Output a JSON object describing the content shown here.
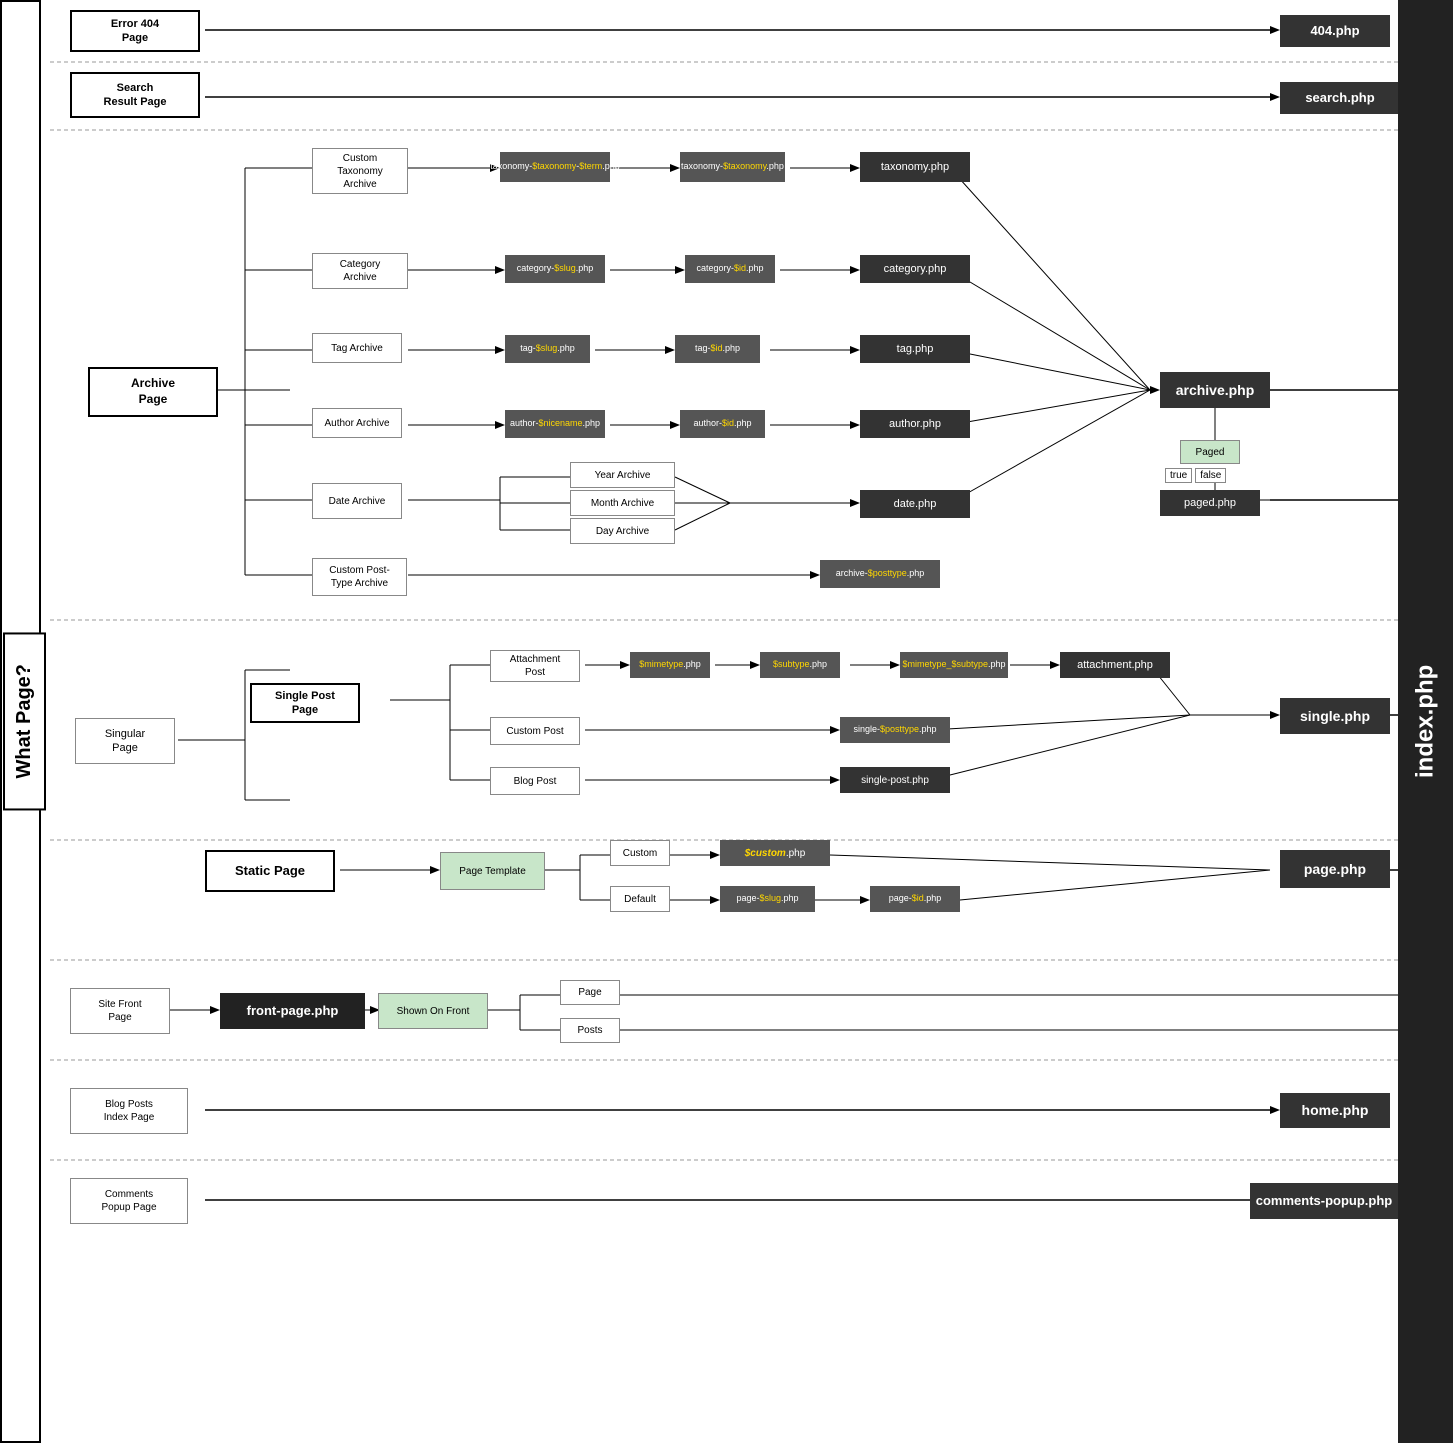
{
  "labels": {
    "what_page": "What Page?",
    "index_php": "index.php"
  },
  "sections": [
    {
      "id": "error404",
      "label": "Error 404\nPage",
      "y_pct": 2
    },
    {
      "id": "search",
      "label": "Search\nResult Page",
      "y_pct": 7
    },
    {
      "id": "archive",
      "label": "Archive\nPage",
      "y_pct": 28
    },
    {
      "id": "singular",
      "label": "Singular\nPage",
      "y_pct": 55
    },
    {
      "id": "static",
      "label": "Static Page",
      "y_pct": 74
    },
    {
      "id": "sitefront",
      "label": "Site Front\nPage",
      "y_pct": 84
    },
    {
      "id": "blogposts",
      "label": "Blog Posts\nIndex Page",
      "y_pct": 91
    },
    {
      "id": "comments",
      "label": "Comments\nPopup Page",
      "y_pct": 96
    }
  ],
  "file_nodes": {
    "php_404": "404.php",
    "search_php": "search.php",
    "taxonomy_php": "taxonomy.php",
    "category_php": "category.php",
    "tag_php": "tag.php",
    "author_php": "author.php",
    "date_php": "date.php",
    "archive_php": "archive.php",
    "attachment_php": "attachment.php",
    "single_php": "single.php",
    "page_php": "page.php",
    "front_page_php": "front-page.php",
    "home_php": "home.php",
    "comments_popup_php": "comments-popup.php",
    "paged_php": "paged.php",
    "index_php": "index.php"
  },
  "intermediate_nodes": {
    "custom_taxonomy": "Custom\nTaxonomy\nArchive",
    "category_archive": "Category\nArchive",
    "tag_archive": "Tag Archive",
    "author_archive": "Author Archive",
    "date_archive": "Date Archive",
    "custom_post_type": "Custom Post-\nType Archive",
    "attachment_post": "Attachment\nPost",
    "single_post_page": "Single Post\nPage",
    "custom_post": "Custom Post",
    "blog_post": "Blog Post",
    "static_page": "Static Page",
    "page_template": "Page Template",
    "shown_on_front": "Shown On Front",
    "year_archive": "Year Archive",
    "month_archive": "Month Archive",
    "day_archive": "Day Archive"
  },
  "template_nodes": {
    "tax_term": "taxonomy-$taxonomy-$term.php",
    "tax_taxonomy": "taxonomy-$taxonomy.php",
    "cat_slug": "category-$slug.php",
    "cat_id": "category-$id.php",
    "tag_slug": "tag-$slug.php",
    "tag_id": "tag-$id.php",
    "author_nicename": "author-$nicename.php",
    "author_id": "author-$id.php",
    "archive_posttype": "archive-$posttype.php",
    "mimetype": "$mimetype.php",
    "subtype": "$subtype.php",
    "mimetype_subtype": "$mimetype_$subtype.php",
    "single_posttype": "single-$posttype.php",
    "single_post": "single-post.php",
    "custom_php": "$custom.php",
    "page_slug": "page-$slug.php",
    "page_id": "page-$id.php",
    "paged": "Paged",
    "custom_label": "Custom",
    "default_label": "Default",
    "page_label": "Page",
    "posts_label": "Posts",
    "true_label": "true",
    "false_label": "false"
  }
}
